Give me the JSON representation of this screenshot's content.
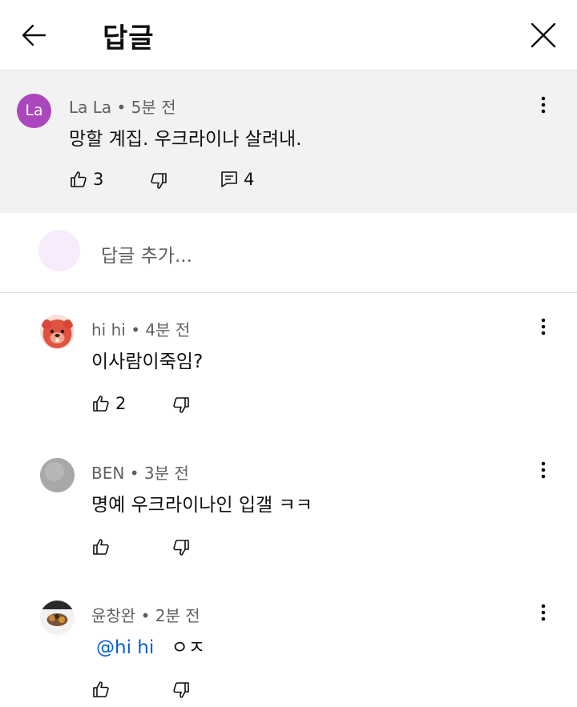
{
  "header": {
    "title": "답글"
  },
  "parent_comment": {
    "avatar_initials": "La",
    "avatar_color": "#ab47bc",
    "author": "La La",
    "time": "5분 전",
    "text": "망할 계집. 우크라이나 살려내.",
    "likes": "3",
    "replies": "4"
  },
  "add_reply": {
    "placeholder": "답글 추가..."
  },
  "replies": [
    {
      "author": "hi hi",
      "time": "4분 전",
      "text": "이사람이죽임?",
      "likes": "2"
    },
    {
      "author": "BEN",
      "time": "3분 전",
      "text": "명예 우크라이나인 입갤 ㅋㅋ",
      "likes": ""
    },
    {
      "author": "윤창완",
      "time": "2분 전",
      "mention": "@hi hi",
      "text": "ㅇㅈ",
      "likes": ""
    }
  ],
  "separator": "•",
  "colors": {
    "mention": "#065fd4",
    "parent_bg": "#f2f2f2",
    "meta": "#606060"
  },
  "icons": [
    "back-arrow-icon",
    "close-icon",
    "thumb-up-icon",
    "thumb-down-icon",
    "reply-icon",
    "more-vert-icon"
  ]
}
